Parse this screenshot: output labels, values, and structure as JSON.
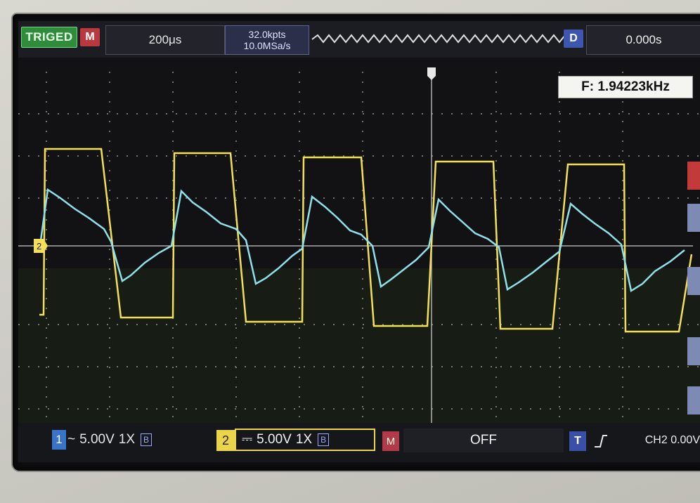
{
  "topbar": {
    "trig_status": "TRIGED",
    "mode_badge": "M",
    "timebase": "200μs",
    "mem_depth": "32.0kpts",
    "sample_rate": "10.0MSa/s",
    "delay_badge": "D",
    "delay_value": "0.000s"
  },
  "measurement": {
    "frequency": "F: 1.94223kHz"
  },
  "channels": {
    "ch1": {
      "number": "1",
      "coupling": "~",
      "scale": "5.00V",
      "probe": "1X",
      "bw": "B",
      "color": "#7fd6e3"
    },
    "ch2": {
      "number": "2",
      "coupling": "⎓",
      "scale": "5.00V",
      "probe": "1X",
      "bw": "B",
      "color": "#f2e05a"
    }
  },
  "math": {
    "badge": "M",
    "state": "OFF"
  },
  "trigger": {
    "badge": "T",
    "edge_icon": "rising-edge-icon",
    "source_level": "CH2 0.00V"
  },
  "markers": {
    "ch2_ground": "2"
  }
}
